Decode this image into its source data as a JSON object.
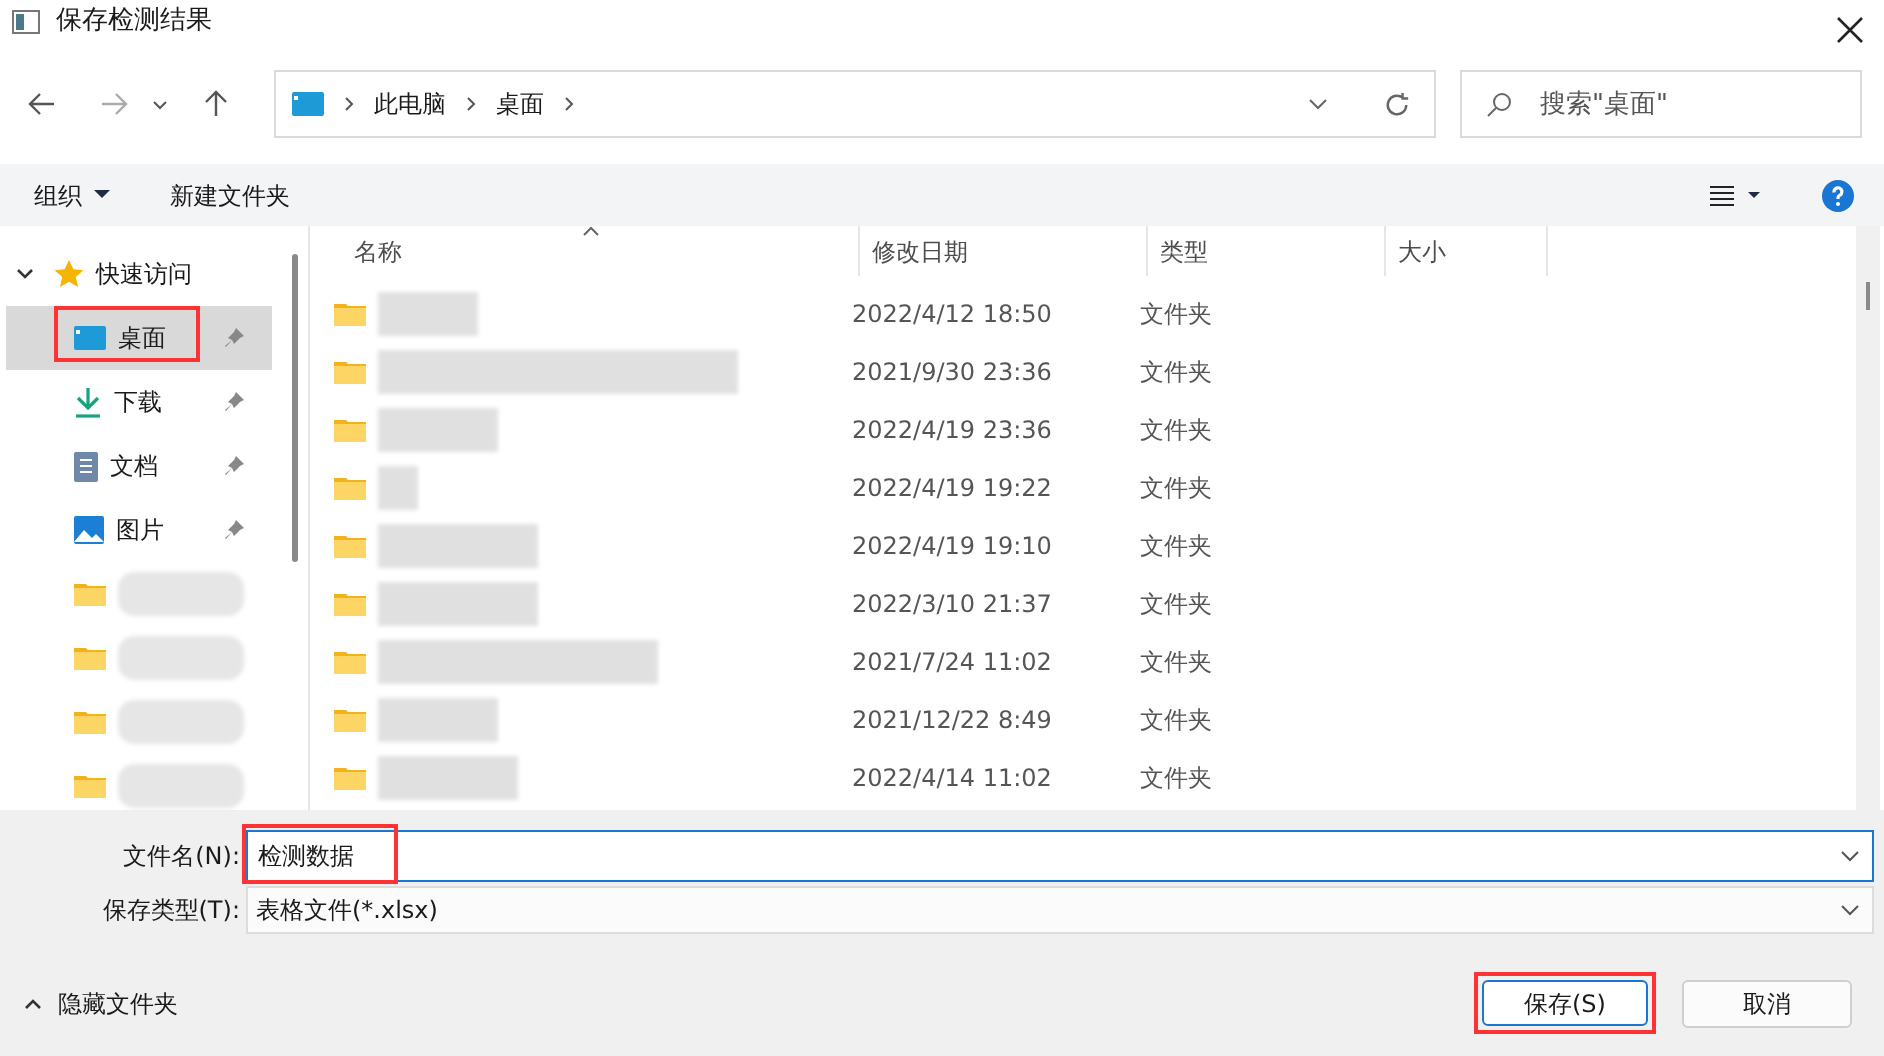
{
  "window": {
    "title": "保存检测结果"
  },
  "address": {
    "path": [
      "此电脑",
      "桌面"
    ]
  },
  "search": {
    "placeholder": "搜索\"桌面\""
  },
  "toolbar": {
    "organize": "组织",
    "new_folder": "新建文件夹"
  },
  "sidebar": {
    "items": [
      {
        "kind": "group",
        "label": "快速访问",
        "expanded": true
      },
      {
        "kind": "desktop",
        "label": "桌面",
        "pinned": true,
        "selected": true,
        "highlighted": true
      },
      {
        "kind": "download",
        "label": "下载",
        "pinned": true,
        "selected": false,
        "highlighted": false
      },
      {
        "kind": "document",
        "label": "文档",
        "pinned": true,
        "selected": false,
        "highlighted": false
      },
      {
        "kind": "image",
        "label": "图片",
        "pinned": true,
        "selected": false,
        "highlighted": false
      },
      {
        "kind": "folder",
        "selected": false,
        "highlighted": false
      },
      {
        "kind": "folder",
        "selected": false,
        "highlighted": false
      },
      {
        "kind": "folder",
        "selected": false,
        "highlighted": false
      },
      {
        "kind": "folder",
        "selected": false,
        "highlighted": false
      }
    ]
  },
  "table": {
    "columns": [
      "名称",
      "修改日期",
      "类型",
      "大小"
    ],
    "rows": [
      {
        "modified": "2022/4/12 18:50",
        "type": "文件夹"
      },
      {
        "modified": "2021/9/30 23:36",
        "type": "文件夹"
      },
      {
        "modified": "2022/4/19 23:36",
        "type": "文件夹"
      },
      {
        "modified": "2022/4/19 19:22",
        "type": "文件夹"
      },
      {
        "modified": "2022/4/19 19:10",
        "type": "文件夹"
      },
      {
        "modified": "2022/3/10 21:37",
        "type": "文件夹"
      },
      {
        "modified": "2021/7/24 11:02",
        "type": "文件夹"
      },
      {
        "modified": "2021/12/22 8:49",
        "type": "文件夹"
      },
      {
        "modified": "2022/4/14 11:02",
        "type": "文件夹"
      }
    ]
  },
  "form": {
    "file_name_label": "文件名(N):",
    "file_name": "检测数据",
    "file_name_highlighted": true,
    "file_type_label": "保存类型(T):",
    "file_type": "表格文件(*.xlsx)"
  },
  "footer": {
    "hide_folders": "隐藏文件夹",
    "save": "保存(S)",
    "save_highlighted": true,
    "cancel": "取消"
  }
}
